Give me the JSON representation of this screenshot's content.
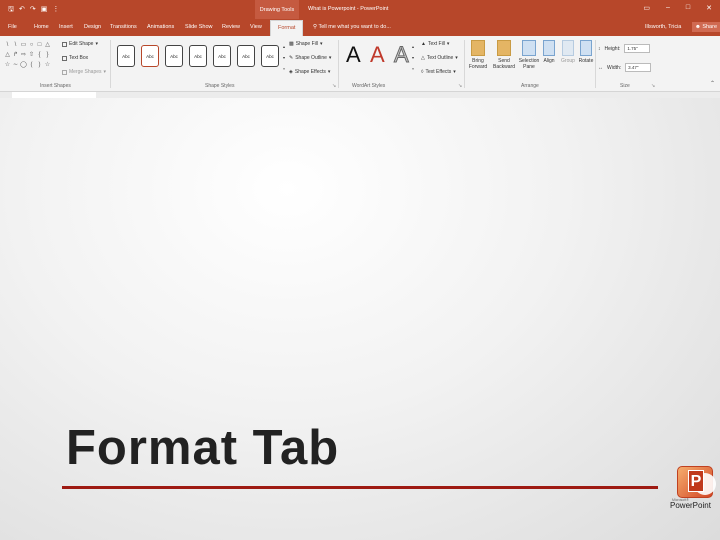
{
  "titlebar": {
    "qat_icons": [
      "save-icon",
      "undo-icon",
      "redo-icon",
      "present-icon",
      "customize-icon"
    ],
    "context_label": "Drawing Tools",
    "doc_title": "What is Powerpoint - PowerPoint",
    "window_buttons": [
      "▭",
      "–",
      "□",
      "✕"
    ]
  },
  "tabs": [
    "File",
    "Home",
    "Insert",
    "Design",
    "Transitions",
    "Animations",
    "Slide Show",
    "Review",
    "View",
    "Format"
  ],
  "active_tab": "Format",
  "tellme": "Tell me what you want to do...",
  "user": "Illsworth, Tricia",
  "share": "Share",
  "ribbon": {
    "insert_shapes": {
      "label": "Insert Shapes",
      "edit_shape": "Edit Shape",
      "text_box": "Text Box",
      "merge_shapes": "Merge Shapes"
    },
    "shape_styles": {
      "label": "Shape Styles",
      "abc": [
        "Abc",
        "Abc",
        "Abc",
        "Abc",
        "Abc",
        "Abc",
        "Abc"
      ],
      "shape_fill": "Shape Fill",
      "shape_outline": "Shape Outline",
      "shape_effects": "Shape Effects"
    },
    "wordart": {
      "label": "WordArt Styles",
      "letters": [
        "A",
        "A",
        "A"
      ],
      "text_fill": "Text Fill",
      "text_outline": "Text Outline",
      "text_effects": "Text Effects"
    },
    "arrange": {
      "label": "Arrange",
      "bring_forward": "Bring Forward",
      "send_backward": "Send Backward",
      "selection_pane": "Selection Pane",
      "align": "Align",
      "group": "Group",
      "rotate": "Rotate"
    },
    "size": {
      "label": "Size",
      "height_label": "Height:",
      "height_value": "1.75\"",
      "width_label": "Width:",
      "width_value": "3.47\""
    }
  },
  "slide": {
    "title": "Format Tab",
    "accent_color": "#9e1a12"
  },
  "logo": {
    "small": "Microsoft®",
    "text": "PowerPoint",
    "letter": "P"
  }
}
